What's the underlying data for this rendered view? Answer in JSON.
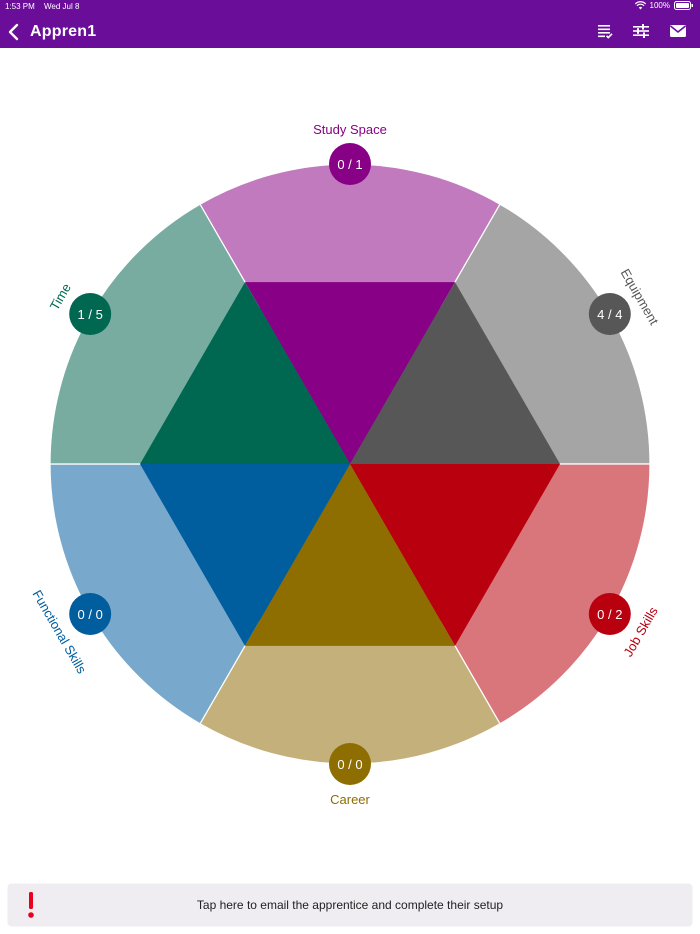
{
  "status_bar": {
    "time": "1:53 PM",
    "date": "Wed Jul 8",
    "battery": "100%"
  },
  "nav": {
    "title": "Appren1",
    "icons": [
      "back-chevron-icon",
      "checklist-icon",
      "sliders-icon",
      "mail-icon"
    ]
  },
  "wheel": {
    "segments": [
      {
        "name": "Study Space",
        "score": "0 / 1",
        "inner_color": "#870085",
        "outer_color": "#c07abd"
      },
      {
        "name": "Equipment",
        "score": "4 / 4",
        "inner_color": "#575757",
        "outer_color": "#a5a5a5"
      },
      {
        "name": "Job Skills",
        "score": "0 / 2",
        "inner_color": "#b9000f",
        "outer_color": "#d9767b"
      },
      {
        "name": "Career",
        "score": "0 / 0",
        "inner_color": "#8e6e00",
        "outer_color": "#c4b07a"
      },
      {
        "name": "Functional Skills",
        "score": "0 / 0",
        "inner_color": "#005d9e",
        "outer_color": "#78a9cc"
      },
      {
        "name": "Time",
        "score": "1 / 5",
        "inner_color": "#006850",
        "outer_color": "#78aca1"
      }
    ]
  },
  "banner": {
    "message": "Tap here to email the apprentice and complete their setup",
    "alert_color": "#e8001c"
  },
  "colors": {
    "header": "#6a0d99",
    "background": "#ffffff",
    "banner_bg": "#efedf2"
  }
}
